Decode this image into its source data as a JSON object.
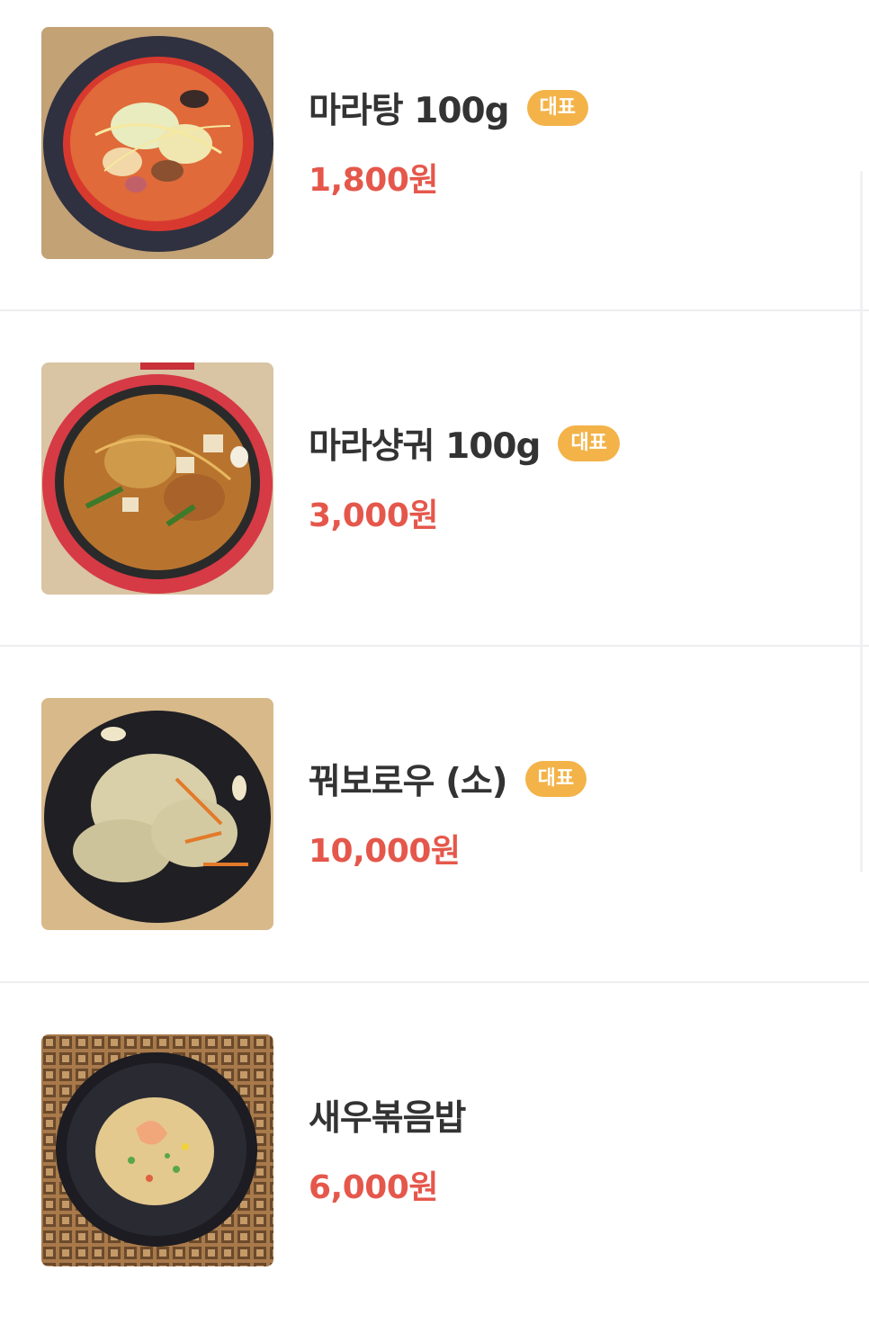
{
  "menu": {
    "items": [
      {
        "name": "마라탕 100g",
        "badge": "대표",
        "price": "1,800원",
        "photo_icon": "malatang-bowl-photo"
      },
      {
        "name": "마라샹궈 100g",
        "badge": "대표",
        "price": "3,000원",
        "photo_icon": "malaxiangguo-plate-photo"
      },
      {
        "name": "꿔보로우 (소)",
        "badge": "대표",
        "price": "10,000원",
        "photo_icon": "guobaorou-plate-photo"
      },
      {
        "name": "새우볶음밥",
        "price": "6,000원",
        "photo_icon": "shrimp-fried-rice-photo"
      }
    ]
  },
  "colors": {
    "badge_bg": "#f3b349",
    "price": "#e5574b",
    "name": "#333333",
    "divider": "#eceef0"
  }
}
